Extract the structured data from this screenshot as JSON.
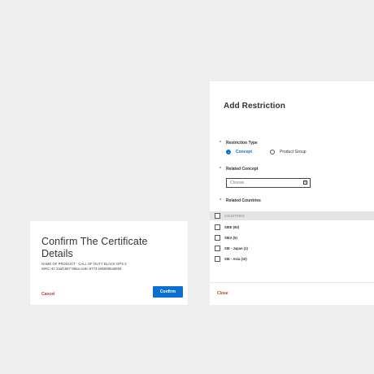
{
  "certificate_dialog": {
    "title": "Confirm The Certificate Details",
    "product_line": "NAME OF PRODUCT : CALL OF DUTY BLACK OPS 2",
    "wrc_line": "WRC ID: 2aaf1587-966a-4c9c-8773-e95989ba8559",
    "cancel_label": "Cancel",
    "confirm_label": "Confirm"
  },
  "restriction_dialog": {
    "title": "Add Restriction",
    "restriction_type_label": "Restriction Type",
    "restriction_options": [
      "Concept",
      "Product Group"
    ],
    "selected_option": "Concept",
    "related_concept_label": "Related Concept",
    "select_placeholder": "Choose",
    "related_countries_label": "Related Countries",
    "countries_header": "COUNTRIES",
    "countries": [
      "SIEE (50)",
      "SIEA (5)",
      "SIE - Japan (1)",
      "SIE - Asia (10)"
    ],
    "close_label": "Close"
  },
  "colors": {
    "primary": "#0b6fd1",
    "danger": "#c0392b",
    "background": "#efefef"
  }
}
